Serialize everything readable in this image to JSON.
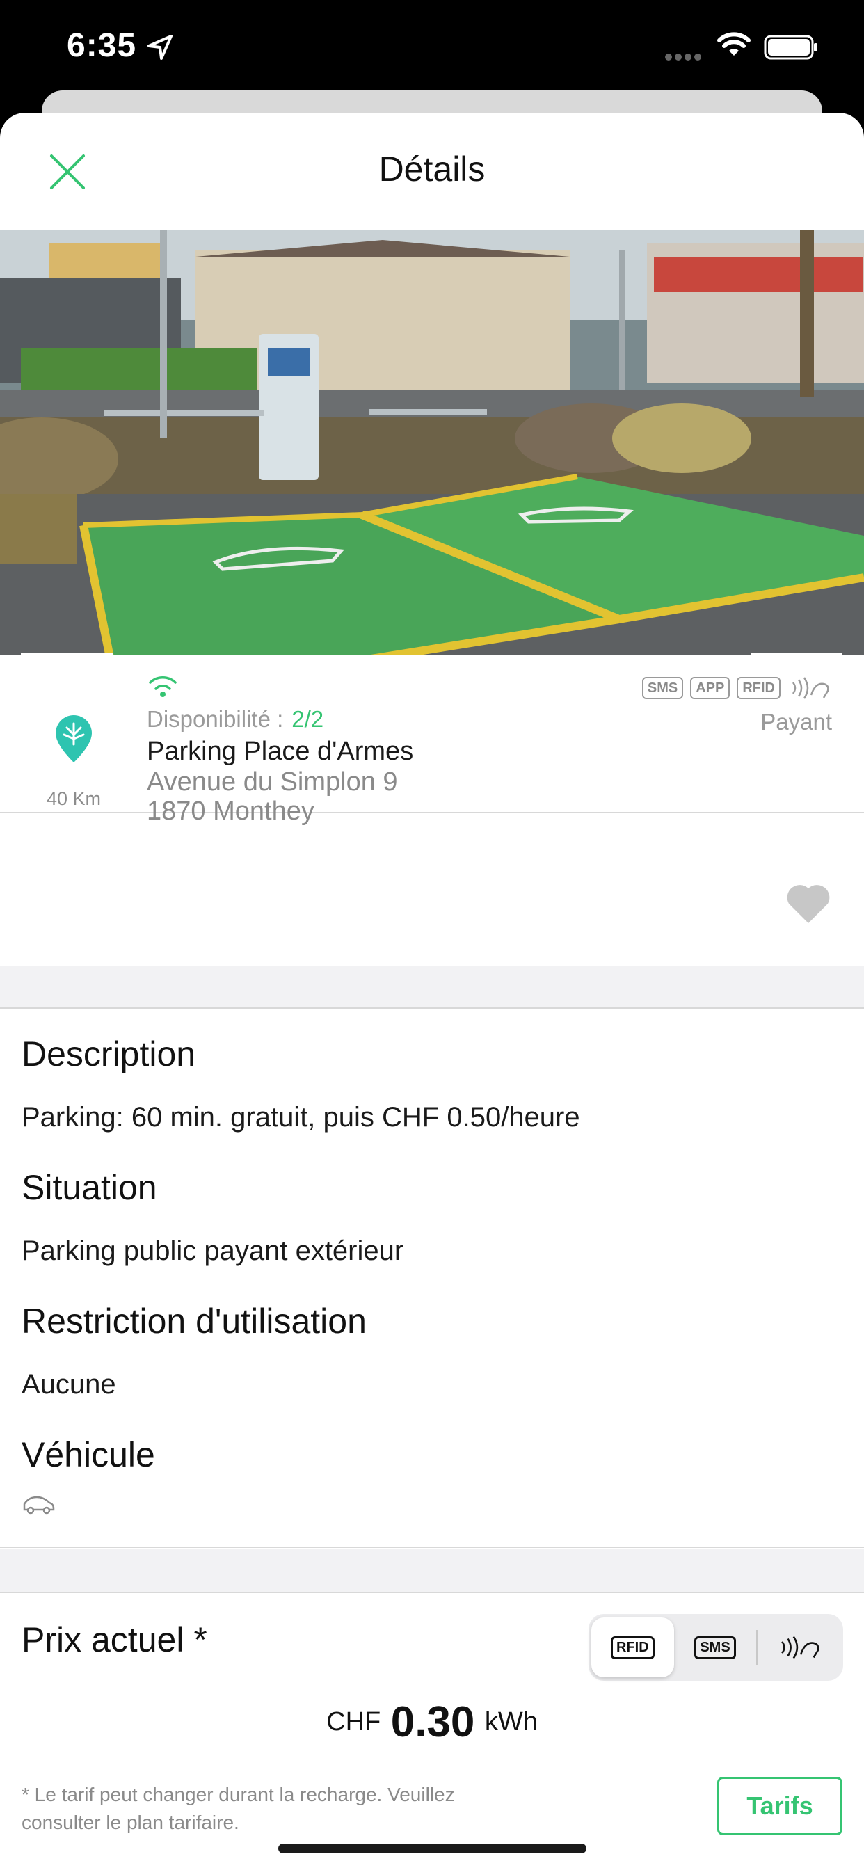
{
  "status_bar": {
    "time": "6:35"
  },
  "header": {
    "title": "Détails"
  },
  "station": {
    "distance": "40 Km",
    "availability_label": "Disponibilité :",
    "availability_value": "2/2",
    "name": "Parking Place d'Armes",
    "street": "Avenue du Simplon 9",
    "city": "1870 Monthey",
    "payment_methods": [
      "SMS",
      "APP",
      "RFID"
    ],
    "pricing_type": "Payant"
  },
  "details": {
    "description_title": "Description",
    "description_text": "Parking: 60 min. gratuit, puis CHF 0.50/heure",
    "situation_title": "Situation",
    "situation_text": "Parking public payant extérieur",
    "restriction_title": "Restriction d'utilisation",
    "restriction_text": "Aucune",
    "vehicle_title": "Véhicule"
  },
  "price": {
    "title": "Prix actuel *",
    "tabs": [
      "RFID",
      "SMS"
    ],
    "currency": "CHF",
    "value": "0.30",
    "unit": "kWh",
    "footnote": "* Le tarif peut changer durant la recharge. Veuillez consulter le plan tarifaire.",
    "tarifs_label": "Tarifs"
  },
  "colors": {
    "accent_green": "#35c472",
    "teal_button": "#2ec4b0",
    "pin_teal": "#2ec4b0"
  }
}
